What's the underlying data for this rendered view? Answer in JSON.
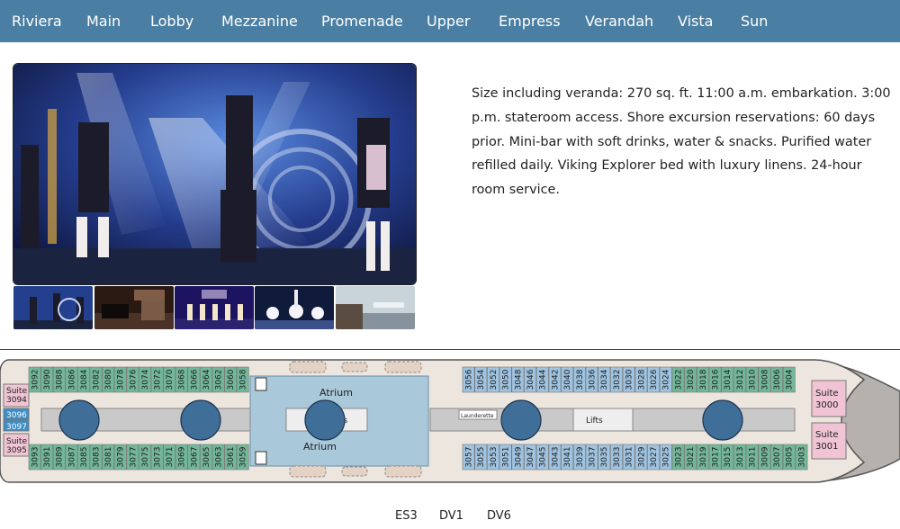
{
  "nav": {
    "items": [
      "Riviera",
      "Main",
      "Lobby",
      "Mezzanine",
      "Promenade",
      "Upper",
      "Empress",
      "Verandah",
      "Vista",
      "Sun"
    ]
  },
  "description": "Size including veranda: 270 sq. ft. 11:00 a.m. embarkation. 3:00 p.m. stateroom access. Shore excursion reservations: 60 days prior. Mini-bar with soft drinks, water & snacks. Purified water refilled daily. Viking Explorer bed with luxury linens. 24-hour room service.",
  "deck": {
    "top_rooms": [
      "3092",
      "3090",
      "3088",
      "3086",
      "3084",
      "3082",
      "3080",
      "3078",
      "3076",
      "3074",
      "3072",
      "3070",
      "3068",
      "3066",
      "3064",
      "3062",
      "3060",
      "3058",
      "3056",
      "3054",
      "3052",
      "3050",
      "3048",
      "3046",
      "3044",
      "3042",
      "3040",
      "3038",
      "3036",
      "3034",
      "3032",
      "3030",
      "3028",
      "3026",
      "3024",
      "3022",
      "3020",
      "3018",
      "3016",
      "3014",
      "3012",
      "3010",
      "3008",
      "3006",
      "3004"
    ],
    "bottom_rooms": [
      "3093",
      "3091",
      "3089",
      "3087",
      "3085",
      "3083",
      "3081",
      "3079",
      "3077",
      "3075",
      "3073",
      "3071",
      "3069",
      "3067",
      "3065",
      "3063",
      "3061",
      "3059",
      "3057",
      "3055",
      "3053",
      "3051",
      "3049",
      "3047",
      "3045",
      "3043",
      "3041",
      "3039",
      "3037",
      "3035",
      "3033",
      "3031",
      "3029",
      "3027",
      "3025",
      "3023",
      "3021",
      "3019",
      "3017",
      "3015",
      "3013",
      "3011",
      "3009",
      "3007",
      "3005",
      "3003"
    ],
    "suite_top_left": "Suite 3094",
    "suite_bottom_left": "Suite 3095",
    "left_center_rooms": [
      "3096",
      "3097"
    ],
    "suite_top_right": "Suite 3000",
    "suite_bottom_right": "Suite 3001",
    "atrium_label": "Atrium",
    "lifts_label": "Lifts",
    "lifts_label_partial": "ts",
    "launderette_label": "Launderette",
    "colors": {
      "room_blue": "#9fc3e0",
      "room_green": "#73b79a",
      "suite_pink": "#f0c4d4",
      "left_center_blue": "#3a8ec7",
      "marker": "#3f6f99",
      "atrium": "#a9c8da",
      "hull": "#b7b1ad",
      "nav": "#4a7fa3"
    }
  },
  "legend": [
    "ES3",
    "DV1",
    "DV6"
  ]
}
